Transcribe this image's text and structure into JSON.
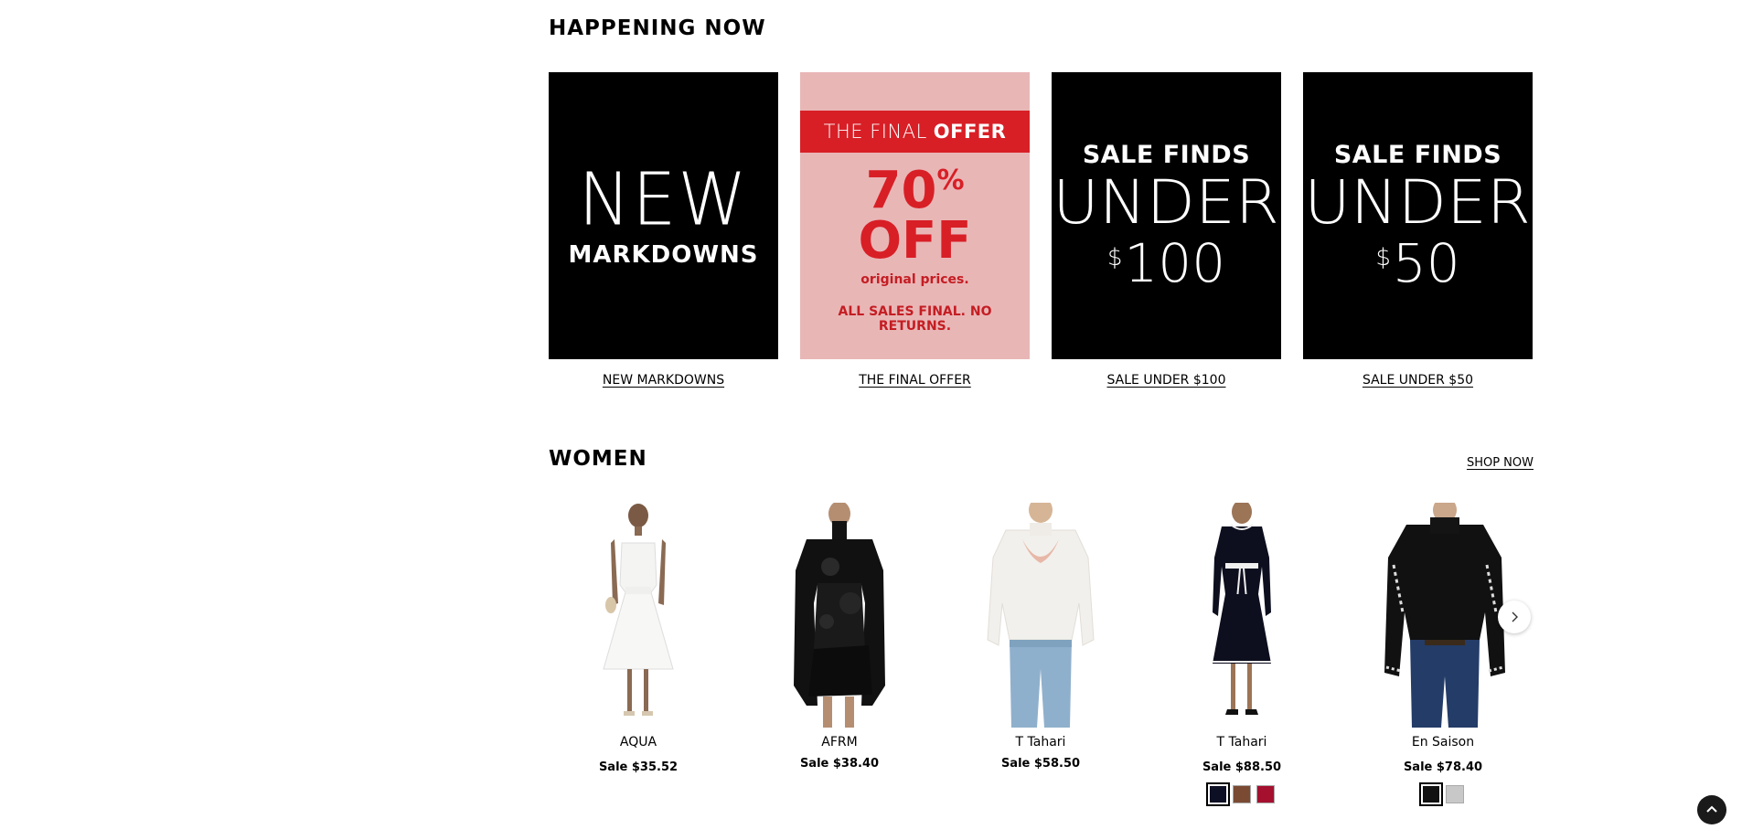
{
  "happening": {
    "title": "HAPPENING NOW",
    "tiles": [
      {
        "art_line1": "NEW",
        "art_line2": "MARKDOWNS",
        "link": "NEW MARKDOWNS"
      },
      {
        "banner_light": "THE FINAL",
        "banner_bold": "OFFER",
        "pct": "70",
        "pct_sign": "%",
        "off": "OFF",
        "orig": "original prices.",
        "final": "ALL SALES FINAL. NO RETURNS.",
        "link": "THE FINAL OFFER"
      },
      {
        "art_line1": "SALE FINDS",
        "art_line2": "UNDER",
        "dollar": "$",
        "amount": "100",
        "link": "SALE UNDER $100"
      },
      {
        "art_line1": "SALE FINDS",
        "art_line2": "UNDER",
        "dollar": "$",
        "amount": "50",
        "link": "SALE UNDER $50"
      }
    ]
  },
  "women": {
    "title": "WOMEN",
    "shop_now": "SHOP NOW",
    "products": [
      {
        "brand": "AQUA",
        "price": "Sale $35.52"
      },
      {
        "brand": "AFRM",
        "price": "Sale $38.40"
      },
      {
        "brand": "T Tahari",
        "price": "Sale $58.50"
      },
      {
        "brand": "T Tahari",
        "price": "Sale $88.50",
        "swatches": [
          "#0d0f24",
          "#7a4a33",
          "#a5102f"
        ]
      },
      {
        "brand": "En Saison",
        "price": "Sale $78.40",
        "swatches": [
          "#111111",
          "#c8c8c8"
        ]
      }
    ]
  },
  "icons": {
    "next": "chevron-right-icon",
    "top": "chevron-up-icon"
  },
  "colors": {
    "sale_red": "#d81f26",
    "final_offer_bg": "#e9b6b6"
  }
}
